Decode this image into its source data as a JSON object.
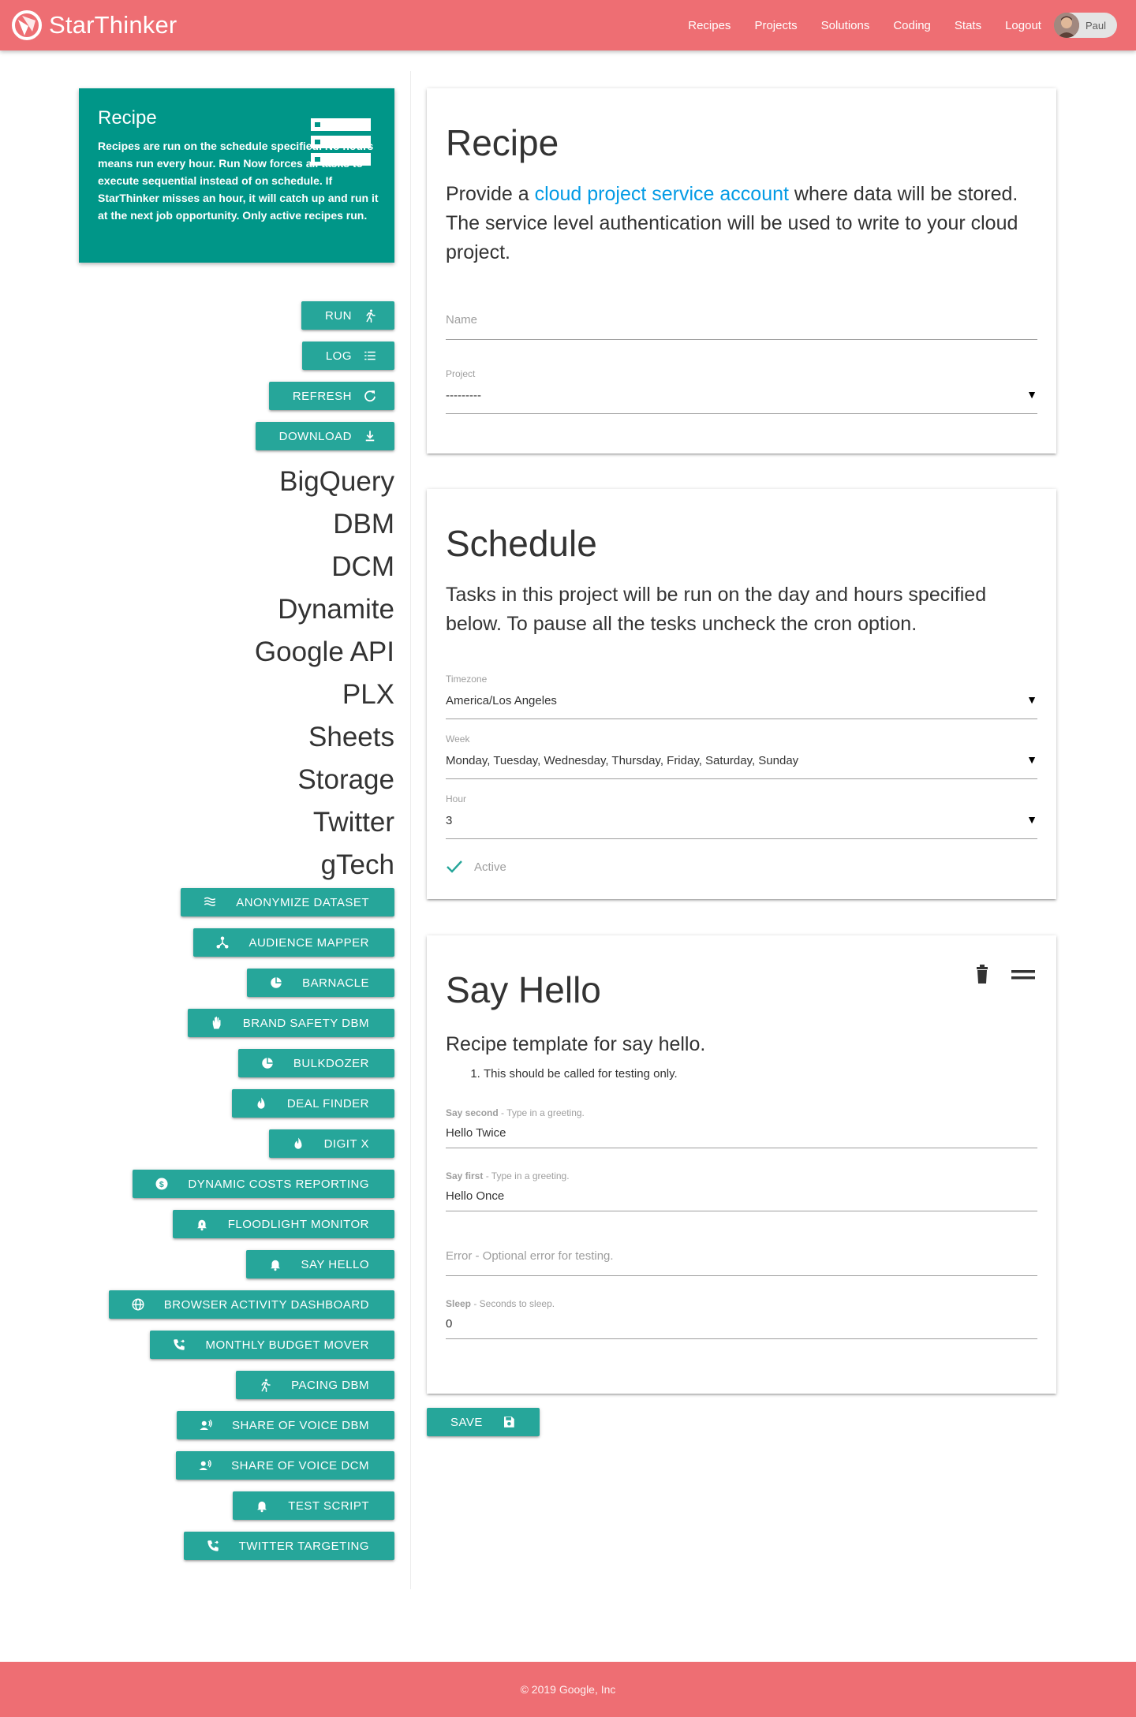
{
  "header": {
    "brand": "StarThinker",
    "nav": [
      "Recipes",
      "Projects",
      "Solutions",
      "Coding",
      "Stats",
      "Logout"
    ],
    "user": "Paul",
    "bar_color": "#ee6e73"
  },
  "sidebar": {
    "info": {
      "title": "Recipe",
      "description": "Recipes are run on the schedule specified. No hours means run every hour. Run Now forces all tasks to execute sequential instead of on schedule. If StarThinker misses an hour, it will catch up and run it at the next job opportunity. Only active recipes run.",
      "icon": "list-icon",
      "color": "#009688"
    },
    "actions": [
      {
        "label": "Run",
        "icon": "run-icon"
      },
      {
        "label": "Log",
        "icon": "list-icon"
      },
      {
        "label": "Refresh",
        "icon": "refresh-icon"
      },
      {
        "label": "Download",
        "icon": "download-icon"
      }
    ],
    "categories": [
      "BigQuery",
      "DBM",
      "DCM",
      "Dynamite",
      "Google API",
      "PLX",
      "Sheets",
      "Storage",
      "Twitter",
      "gTech"
    ],
    "solutions": [
      {
        "label": "Anonymize Dataset",
        "icon": "waves-icon"
      },
      {
        "label": "Audience Mapper",
        "icon": "share-icon"
      },
      {
        "label": "Barnacle",
        "icon": "pie-chart-icon"
      },
      {
        "label": "Brand Safety DBM",
        "icon": "hand-icon"
      },
      {
        "label": "Bulkdozer",
        "icon": "pie-chart-icon"
      },
      {
        "label": "Deal Finder",
        "icon": "flame-icon"
      },
      {
        "label": "DIGIT X",
        "icon": "flame-icon"
      },
      {
        "label": "Dynamic Costs Reporting",
        "icon": "dollar-icon"
      },
      {
        "label": "Floodlight Monitor",
        "icon": "alarm-icon"
      },
      {
        "label": "Say Hello",
        "icon": "bell-icon"
      },
      {
        "label": "Browser Activity Dashboard",
        "icon": "globe-icon"
      },
      {
        "label": "Monthly Budget Mover",
        "icon": "phone-forward-icon"
      },
      {
        "label": "Pacing DBM",
        "icon": "run-icon"
      },
      {
        "label": "Share of Voice DBM",
        "icon": "voice-icon"
      },
      {
        "label": "Share of Voice DCM",
        "icon": "voice-icon"
      },
      {
        "label": "Test Script",
        "icon": "bell-icon"
      },
      {
        "label": "Twitter Targeting",
        "icon": "phone-forward-icon"
      }
    ],
    "button_color": "#26a69a"
  },
  "recipe_card": {
    "title": "Recipe",
    "desc_before": "Provide a ",
    "desc_link": "cloud project service account",
    "desc_after": " where data will be stored. The service level authentication will be used to write to your cloud project.",
    "name_placeholder": "Name",
    "project_label": "Project",
    "project_value": "---------"
  },
  "schedule_card": {
    "title": "Schedule",
    "description": "Tasks in this project will be run on the day and hours specified below. To pause all the tesks uncheck the cron option.",
    "timezone_label": "Timezone",
    "timezone_value": "America/Los Angeles",
    "week_label": "Week",
    "week_value": "Monday, Tuesday, Wednesday, Thursday, Friday, Saturday, Sunday",
    "hour_label": "Hour",
    "hour_value": "3",
    "active_label": "Active",
    "active_checked": true
  },
  "task_card": {
    "title": "Say Hello",
    "description": "Recipe template for say hello.",
    "instruction": "This should be called for testing only.",
    "tools": [
      "trash-icon",
      "drag-handle-icon"
    ],
    "fields": [
      {
        "name": "Say second",
        "hint": " - Type in a greeting.",
        "value": "Hello Twice"
      },
      {
        "name": "Say first",
        "hint": " - Type in a greeting.",
        "value": "Hello Once"
      },
      {
        "name": "Sleep",
        "hint": " - Seconds to sleep.",
        "value": "0"
      }
    ],
    "error_placeholder": "Error - Optional error for testing."
  },
  "save": {
    "label": "Save",
    "icon": "save-icon"
  },
  "footer": {
    "copyright": "© 2019 Google, Inc"
  }
}
